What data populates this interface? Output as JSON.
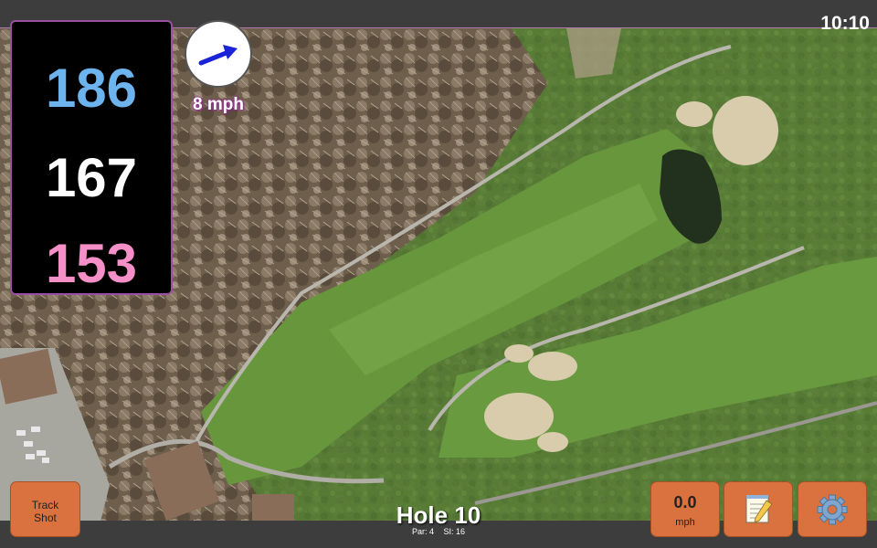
{
  "status": {
    "clock": "10:10"
  },
  "distances": {
    "back": "186",
    "middle": "167",
    "front": "153"
  },
  "wind": {
    "speed": "8 mph",
    "direction_icon": "arrow-northeast"
  },
  "hole": {
    "title": "Hole 10",
    "par": "Par: 4",
    "stroke_index": "SI: 16"
  },
  "buttons": {
    "track_shot_line1": "Track",
    "track_shot_line2": "Shot",
    "speed_value": "0.0",
    "speed_unit": "mph",
    "notes_icon": "notepad-icon",
    "settings_icon": "gear-icon"
  },
  "colors": {
    "back_distance": "#6db3ee",
    "middle_distance": "#ffffff",
    "front_distance": "#f58fc7",
    "button": "#d9723f",
    "panel_border": "#9b4fa0"
  }
}
